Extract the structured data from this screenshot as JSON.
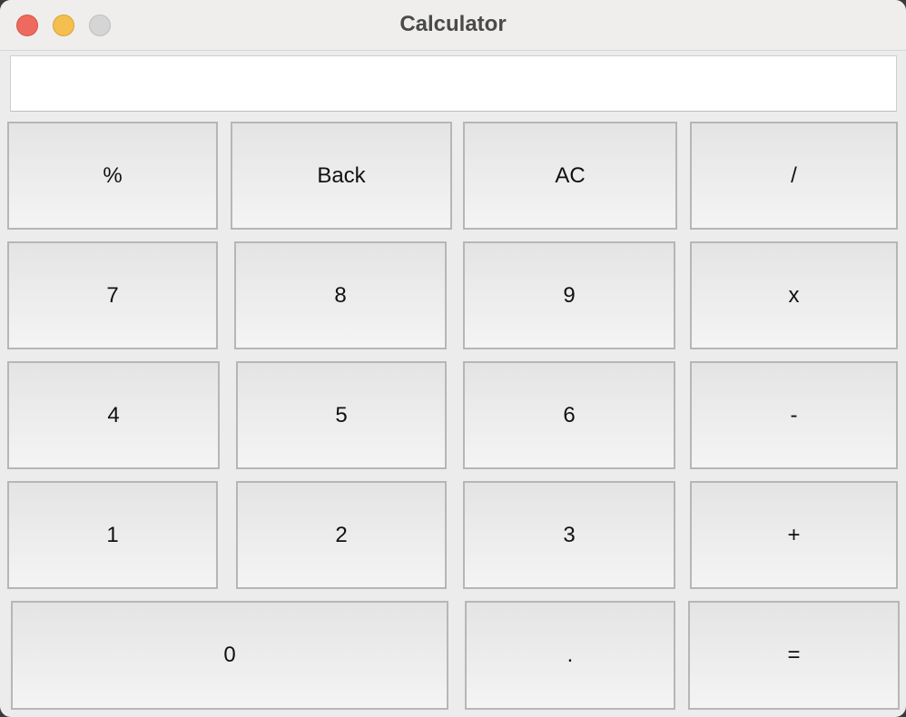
{
  "window": {
    "title": "Calculator"
  },
  "display": {
    "value": ""
  },
  "keys": {
    "percent": "%",
    "back": "Back",
    "ac": "AC",
    "divide": "/",
    "seven": "7",
    "eight": "8",
    "nine": "9",
    "multiply": "x",
    "four": "4",
    "five": "5",
    "six": "6",
    "minus": "-",
    "one": "1",
    "two": "2",
    "three": "3",
    "plus": "+",
    "zero": "0",
    "decimal": ".",
    "equals": "="
  },
  "colors": {
    "close": "#ee6a5e",
    "minimize": "#f5bf4f",
    "zoom": "#d5d5d5",
    "key_border": "#b6b6b6"
  }
}
